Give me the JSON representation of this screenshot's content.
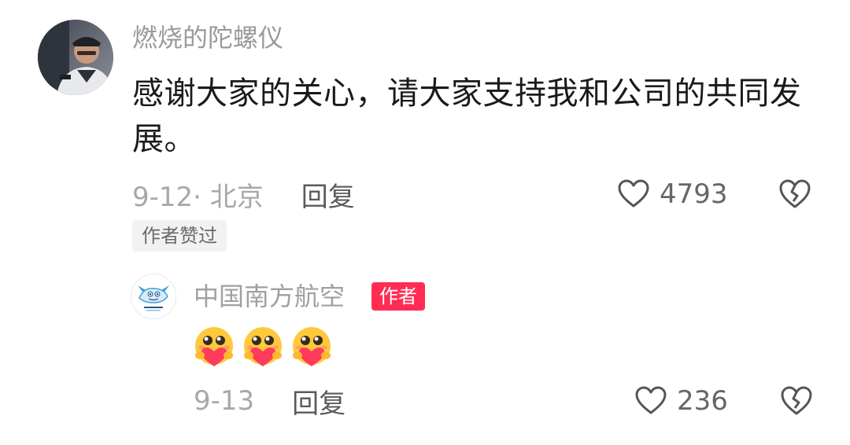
{
  "comment": {
    "username": "燃烧的陀螺仪",
    "text": "感谢大家的关心，请大家支持我和公司的共同发展。",
    "date_location": "9-12· 北京",
    "reply_label": "回复",
    "like_count": "4793",
    "author_liked_tag": "作者赞过"
  },
  "reply": {
    "username": "中国南方航空",
    "author_badge": "作者",
    "emoji_count": 3,
    "emoji_name": "hug-heart-emoji",
    "date": "9-13",
    "reply_label": "回复",
    "like_count": "236"
  },
  "colors": {
    "author_badge_bg": "#ff2c55",
    "muted_text": "#a0a0a0",
    "main_text": "#1a1a1a"
  }
}
